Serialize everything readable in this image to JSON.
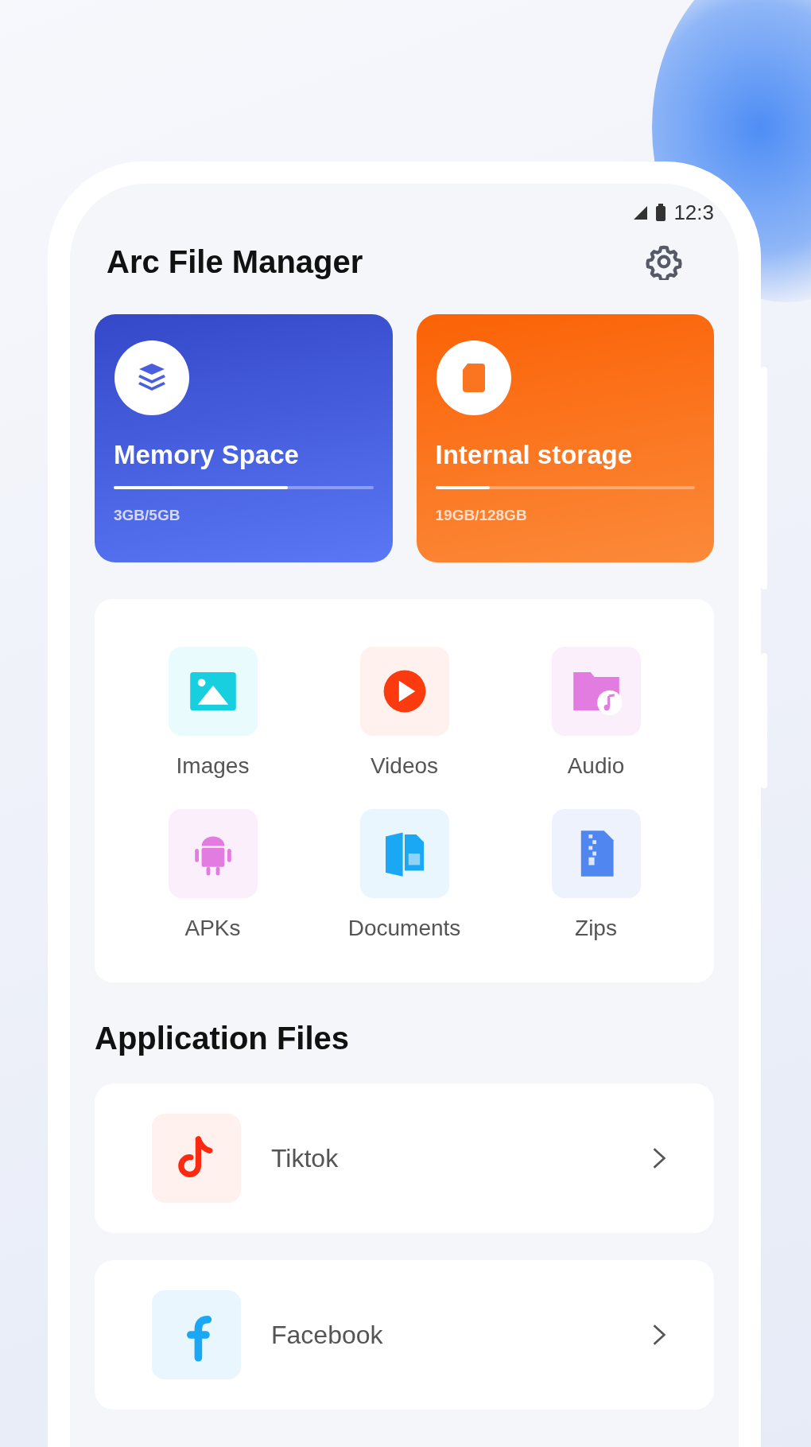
{
  "status_bar": {
    "time": "12:3"
  },
  "app_title": "Arc File Manager",
  "storage_cards": [
    {
      "kind": "memory",
      "title": "Memory Space",
      "usage": "3GB/5GB",
      "level": 0.67
    },
    {
      "kind": "internal",
      "title": "Internal storage",
      "usage": "19GB/128GB",
      "level": 0.21
    }
  ],
  "categories": [
    {
      "kind": "images",
      "label": "Images"
    },
    {
      "kind": "videos",
      "label": "Videos"
    },
    {
      "kind": "audio",
      "label": "Audio"
    },
    {
      "kind": "apks",
      "label": "APKs"
    },
    {
      "kind": "documents",
      "label": "Documents"
    },
    {
      "kind": "zips",
      "label": "Zips"
    }
  ],
  "section_title": "Application Files",
  "apps": [
    {
      "kind": "tiktok",
      "name": "Tiktok"
    },
    {
      "kind": "facebook",
      "name": "Facebook"
    }
  ]
}
